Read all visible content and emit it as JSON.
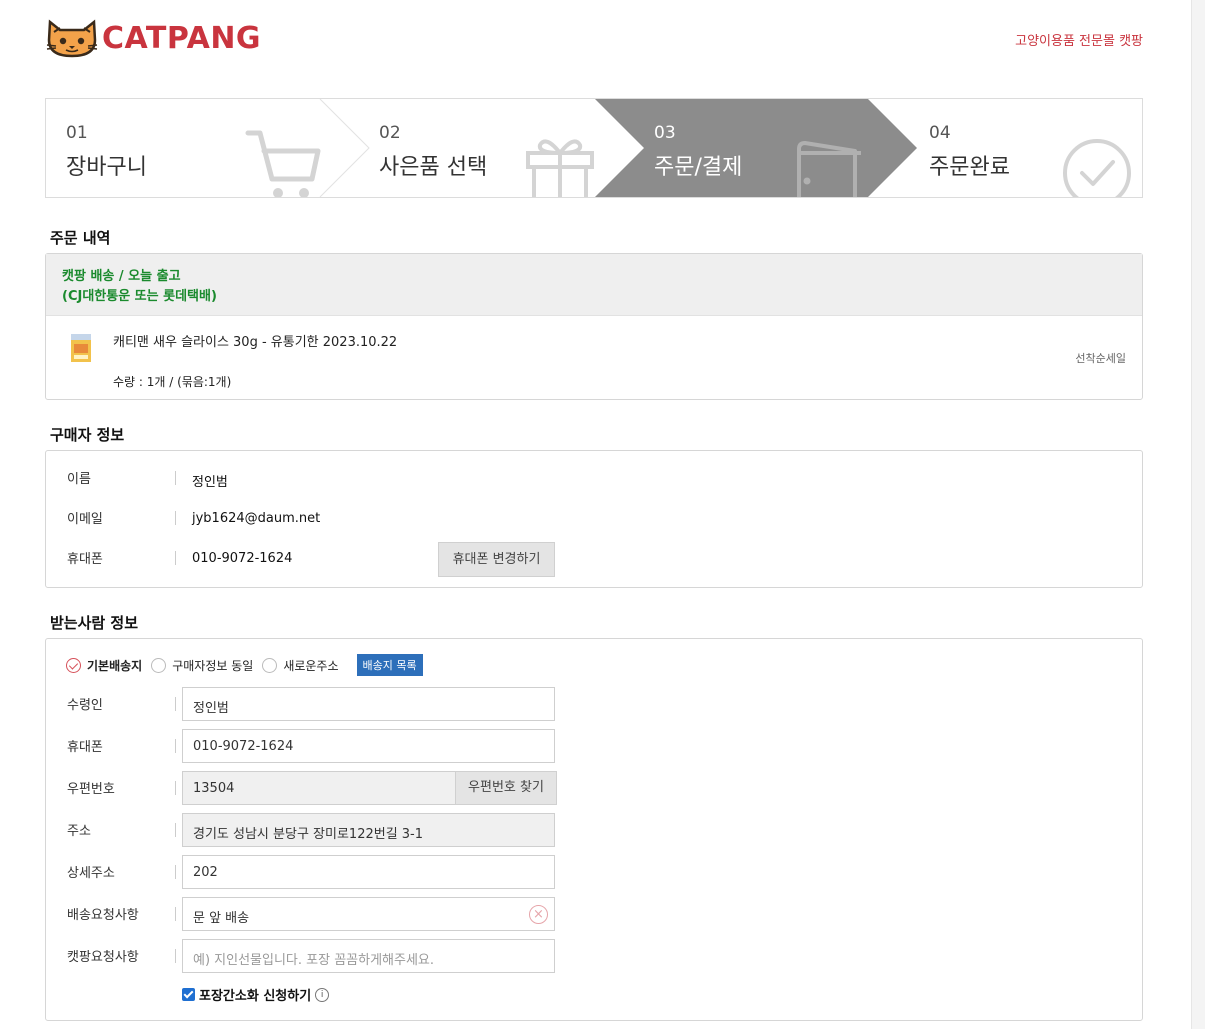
{
  "header": {
    "brand": "CATPANG",
    "tagline": "고양이용품 전문몰 캣팡"
  },
  "steps": [
    {
      "num": "01",
      "label": "장바구니",
      "icon": "cart-icon"
    },
    {
      "num": "02",
      "label": "사은품 선택",
      "icon": "gift-icon"
    },
    {
      "num": "03",
      "label": "주문/결제",
      "icon": "wallet-icon",
      "active": true
    },
    {
      "num": "04",
      "label": "주문완료",
      "icon": "check-circle-icon"
    }
  ],
  "order": {
    "title": "주문 내역",
    "shipping_line1": "캣팡 배송 / 오늘 출고",
    "shipping_line2": "(CJ대한통운 또는 롯데택배)",
    "product_name": "캐티맨 새우 슬라이스 30g - 유통기한 2023.10.22",
    "product_qty": "수량 : 1개 / (묶음:1개)",
    "product_tag": "선착순세일"
  },
  "buyer": {
    "title": "구매자 정보",
    "name_label": "이름",
    "name_value": "정인범",
    "email_label": "이메일",
    "email_value": "jyb1624@daum.net",
    "phone_label": "휴대폰",
    "phone_value": "010-9072-1624",
    "change_phone_button": "휴대폰 변경하기"
  },
  "receiver": {
    "title": "받는사람 정보",
    "options": [
      "기본배송지",
      "구매자정보 동일",
      "새로운주소"
    ],
    "address_list_button": "배송지 목록",
    "recipient_label": "수령인",
    "recipient_value": "정인범",
    "phone_label": "휴대폰",
    "phone_value": "010-9072-1624",
    "zip_label": "우편번호",
    "zip_value": "13504",
    "zip_button": "우편번호 찾기",
    "address_label": "주소",
    "address_value": "경기도 성남시 분당구 장미로122번길 3-1",
    "detail_label": "상세주소",
    "detail_value": "202",
    "delivery_request_label": "배송요청사항",
    "delivery_request_value": "문 앞 배송",
    "catpang_request_label": "캣팡요청사항",
    "catpang_request_placeholder": "예) 지인선물입니다. 포장 꼼꼼하게해주세요.",
    "simplify_packaging_label": "포장간소화 신청하기"
  },
  "colors": {
    "brand": "#c9343e",
    "active_step": "#8c8c8c",
    "shipping_text": "#1a8a2d",
    "address_button": "#2d6fba"
  }
}
